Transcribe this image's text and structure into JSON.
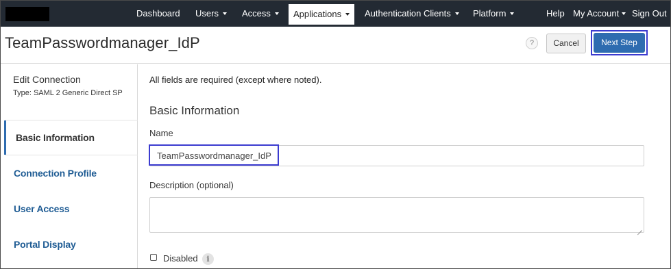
{
  "nav": {
    "items": [
      {
        "label": "Dashboard",
        "dropdown": false
      },
      {
        "label": "Users",
        "dropdown": true
      },
      {
        "label": "Access",
        "dropdown": true
      },
      {
        "label": "Applications",
        "dropdown": true,
        "active": true
      },
      {
        "label": "Authentication Clients",
        "dropdown": true
      },
      {
        "label": "Platform",
        "dropdown": true
      }
    ],
    "help": "Help",
    "account": "My Account",
    "signout": "Sign Out"
  },
  "header": {
    "title": "TeamPasswordmanager_IdP",
    "help_glyph": "?",
    "cancel_label": "Cancel",
    "next_label": "Next Step"
  },
  "sidebar": {
    "heading": "Edit Connection",
    "subheading": "Type: SAML 2 Generic Direct SP",
    "items": [
      {
        "label": "Basic Information",
        "active": true
      },
      {
        "label": "Connection Profile"
      },
      {
        "label": "User Access"
      },
      {
        "label": "Portal Display"
      }
    ]
  },
  "form": {
    "note": "All fields are required (except where noted).",
    "section_title": "Basic Information",
    "name_label": "Name",
    "name_value": "TeamPasswordmanager_IdP",
    "description_label": "Description (optional)",
    "description_value": "",
    "disabled_label": "Disabled",
    "info_glyph": "i"
  },
  "colors": {
    "nav_bg": "#232a33",
    "primary": "#2e6cb0",
    "link": "#1f5c94",
    "highlight_outline": "#3b3bd0"
  }
}
